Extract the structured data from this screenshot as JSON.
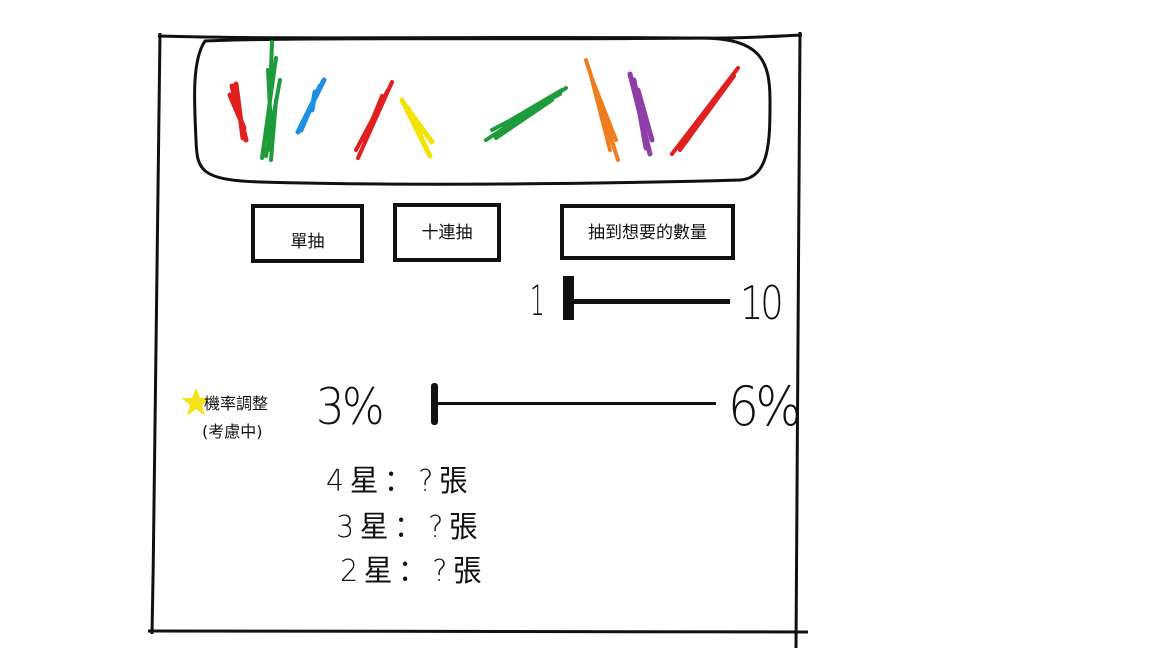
{
  "banner": {
    "stroke_colors": [
      "#e0201f",
      "#1e9b3a",
      "#1b8fe0",
      "#e0201f",
      "#f2e300",
      "#1e9b3a",
      "#f07d1d",
      "#8e3ea6",
      "#e0201f"
    ]
  },
  "buttons": {
    "single_draw": "單抽",
    "ten_draw": "十連抽",
    "draw_until_target": "抽到想要的數量"
  },
  "quantity_slider": {
    "min_label": "1",
    "max_label": "10",
    "value": 1
  },
  "rate_adjust": {
    "label": "機率調整",
    "note": "(考慮中)",
    "min_label": "3%",
    "max_label": "6%",
    "value_percent": 3,
    "star_color": "#f6e21a"
  },
  "results": [
    {
      "stars": "4星",
      "separator": "：",
      "count": "?",
      "unit": "張"
    },
    {
      "stars": "3星",
      "separator": "：",
      "count": "?",
      "unit": "張"
    },
    {
      "stars": "2星",
      "separator": "：",
      "count": "?",
      "unit": "張"
    }
  ]
}
